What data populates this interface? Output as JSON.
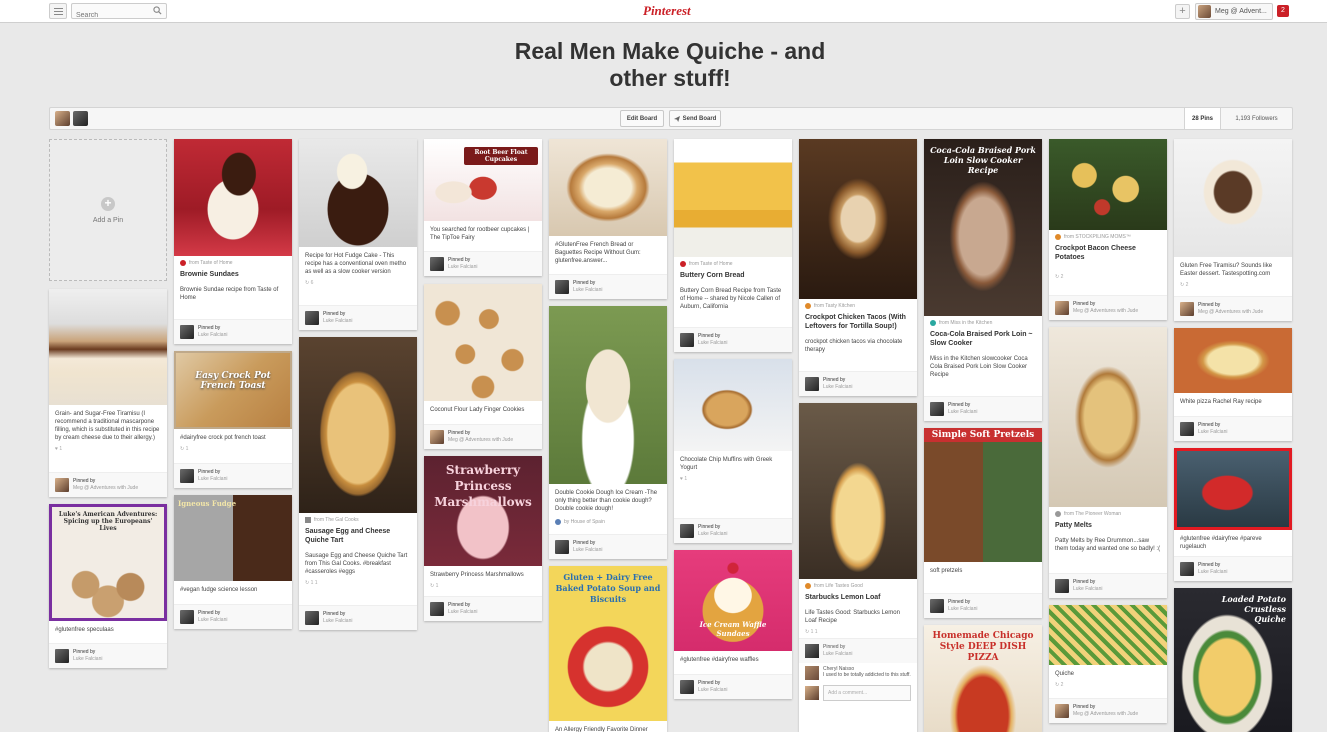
{
  "header": {
    "search_placeholder": "Search",
    "logo": "Pinterest",
    "user_name": "Meg @ Advent...",
    "notifications": "2",
    "add_label": "+"
  },
  "board": {
    "title_line1": "Real Men Make Quiche - and",
    "title_line2": "other stuff!",
    "edit_label": "Edit Board",
    "send_label": "Send Board",
    "pins_label": "28 Pins",
    "followers_label": "1,193 Followers"
  },
  "add_pin": {
    "label": "Add a Pin",
    "icon": "plus-icon"
  },
  "pinned_by": "Pinned by",
  "pins": [
    {
      "id": "tiramisu",
      "desc": "Grain- and Sugar-Free Tiramisu (I recommend a traditional mascarpone filling, which is substituted in this recipe by cream cheese due to their allergy.)",
      "stats": "1",
      "user": "Meg @ Adventures with Jude"
    },
    {
      "id": "speculaas",
      "overlay": "Luke's American Adventures: Spicing up the Europeans' Lives",
      "desc": "#glutenfree speculaas",
      "user": "Luke Falciani"
    },
    {
      "id": "brownie",
      "source": "from Taste of Home",
      "title": "Brownie Sundaes",
      "desc": "Brownie Sundae recipe from Taste of Home",
      "user": "Luke Falciani"
    },
    {
      "id": "frenchtoast",
      "overlay": "Easy Crock Pot French Toast",
      "desc": "#dairyfree crock pot french toast",
      "stats": "1",
      "user": "Luke Falciani"
    },
    {
      "id": "fudge",
      "overlay": "Igneous Fudge",
      "desc": "#vegan fudge science lesson",
      "user": "Luke Falciani"
    },
    {
      "id": "fudgecake",
      "desc": "Recipe for Hot Fudge Cake - This recipe has a conventional oven metho as well as a slow cooker version",
      "stats": "6",
      "user": "Luke Falciani"
    },
    {
      "id": "quiche1",
      "source": "from The Gal Cooks",
      "title": "Sausage Egg and Cheese Quiche Tart",
      "desc": "Sausage Egg and Cheese Quiche Tart from This Gal Cooks. #breakfast #casseroles #eggs",
      "stats": "1   1",
      "user": "Luke Falciani"
    },
    {
      "id": "rootbeer",
      "overlay": "Root Beer Float Cupcakes",
      "desc": "You searched for rootbeer cupcakes | The TipToe Fairy",
      "user": "Luke Falciani"
    },
    {
      "id": "cookies",
      "desc": "Coconut Flour Lady Finger Cookies",
      "user": "Meg @ Adventures with Jude"
    },
    {
      "id": "marshmallows",
      "overlay": "Strawberry Princess Marshmallows",
      "desc": "Strawberry Princess Marshmallows",
      "stats": "1",
      "user": "Luke Falciani"
    },
    {
      "id": "bread",
      "desc": "#GlutenFree French Bread or Baguettes Recipe Without Gum: glutenfree.answer...",
      "user": "Luke Falciani"
    },
    {
      "id": "icecream",
      "desc": "Double Cookie Dough Ice Cream -The only thing better than cookie dough? Double cookie dough!",
      "source2": "by House of Spain",
      "user": "Luke Falciani"
    },
    {
      "id": "soup",
      "overlay": "Gluten + Dairy Free Baked Potato Soup and Biscuits",
      "desc": "An Allergy Friendly Favorite Dinner"
    },
    {
      "id": "cornbread",
      "source": "from Taste of Home",
      "title": "Buttery Corn Bread",
      "desc": "Buttery Corn Bread Recipe from Taste of Home -- shared by Nicole Callen of Auburn, California",
      "user": "Luke Falciani"
    },
    {
      "id": "muffins",
      "desc": "Chocolate Chip Muffins with Greek Yogurt",
      "stats": "1",
      "user": "Luke Falciani"
    },
    {
      "id": "waffles",
      "overlay": "Ice Cream Waffle Sundaes",
      "desc": "#glutenfree #dairyfree waffles",
      "user": "Luke Falciani"
    },
    {
      "id": "tacos",
      "source": "from Tasty Kitchen",
      "title": "Crockpot Chicken Tacos (With Leftovers for Tortilla Soup!)",
      "desc": "crockpot chicken tacos via chocolate therapy",
      "user": "Luke Falciani"
    },
    {
      "id": "lemonloaf",
      "source": "from Life Tastes Good",
      "title": "Starbucks Lemon Loaf",
      "desc": "Life Tastes Good: Starbucks Lemon Loaf Recipe",
      "stats": "1   1",
      "user": "Luke Falciani",
      "comment_user": "Cheryl Naisso",
      "comment_text": "I used to be totally addicted to this stuff.",
      "comment_placeholder": "Add a comment..."
    },
    {
      "id": "porkloin",
      "overlay": "Coca-Cola Braised Pork Loin Slow Cooker Recipe",
      "source": "from Miss in the Kitchen",
      "title": "Coca-Cola Braised Pork Loin ~ Slow Cooker",
      "desc": "Miss in the Kitchen slowcooker Coca Cola Braised Pork Loin Slow Cooker Recipe",
      "user": "Luke Falciani"
    },
    {
      "id": "pretzels",
      "overlay": "Simple Soft Pretzels",
      "desc": "soft pretzels",
      "user": "Luke Falciani"
    },
    {
      "id": "pizza",
      "overlay": "Homemade Chicago Style DEEP DISH PIZZA"
    },
    {
      "id": "potatoes",
      "source": "from STOCKPILING MOMS™",
      "title": "Crockpot Bacon Cheese Potatoes",
      "stats": "2",
      "user": "Meg @ Adventures with Jude"
    },
    {
      "id": "pattymelt",
      "source": "from The Pioneer Woman",
      "title": "Patty Melts",
      "desc": "Patty Melts by Ree Drummon...saw them today and wanted one so badly! :(",
      "user": "Luke Falciani"
    },
    {
      "id": "quiche2",
      "desc": "Quiche",
      "stats": "2",
      "user": "Meg @ Adventures with Jude"
    },
    {
      "id": "gftiramisu",
      "desc": "Gluten Free Tiramisu? Sounds like Easter dessert. Tastespotting.com",
      "stats": "2",
      "user": "Meg @ Adventures with Jude"
    },
    {
      "id": "whitepizza",
      "desc": "White pizza Rachel Ray recipe",
      "user": "Luke Falciani"
    },
    {
      "id": "rugelach",
      "desc": "#glutenfree #dairyfree #pareve rugelauch",
      "user": "Luke Falciani"
    },
    {
      "id": "potatoquiche",
      "overlay": "Loaded Potato Crustless Quiche"
    }
  ]
}
